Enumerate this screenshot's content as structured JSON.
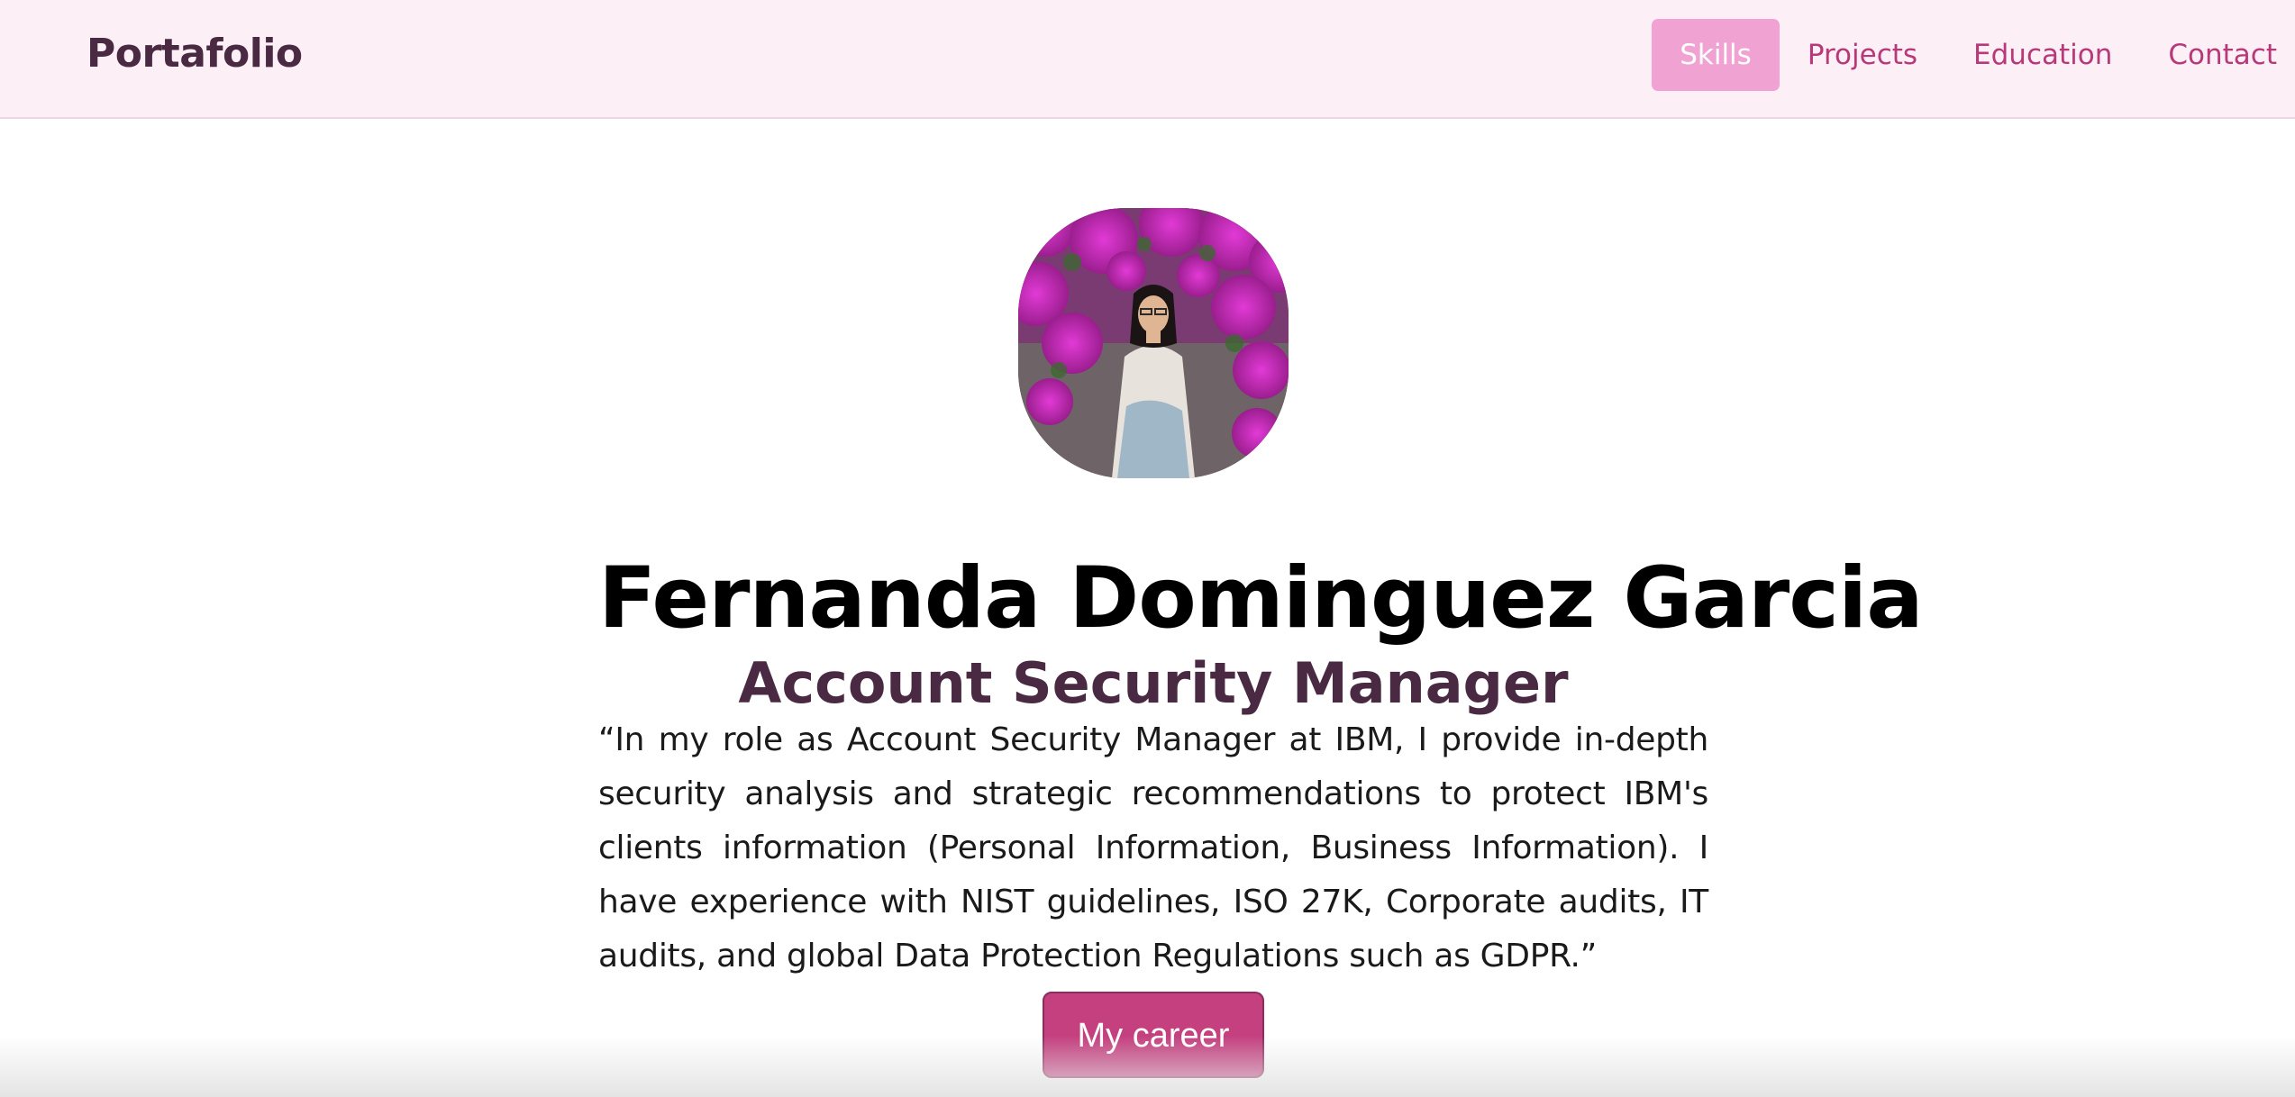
{
  "navbar": {
    "brand": "Portafolio",
    "links": [
      {
        "label": "Skills",
        "active": true
      },
      {
        "label": "Projects",
        "active": false
      },
      {
        "label": "Education",
        "active": false
      },
      {
        "label": "Contact",
        "active": false
      }
    ]
  },
  "hero": {
    "name": "Fernanda Dominguez Garcia",
    "role": "Account Security Manager",
    "bio": "“In my role as Account Security Manager at IBM, I provide in-depth security analysis and strategic recommendations to protect IBM's clients information (Personal Information, Business Information). I have experience with NIST guidelines, ISO 27K, Corporate audits, IT audits, and global Data Protection Regulations such as GDPR.”",
    "cta_label": "My career"
  },
  "colors": {
    "navbar_bg": "#fcf0f6",
    "nav_link": "#b8397a",
    "nav_active_bg": "#f0a3d2",
    "brand_text": "#4a2a42",
    "button_bg": "#c4407f"
  }
}
